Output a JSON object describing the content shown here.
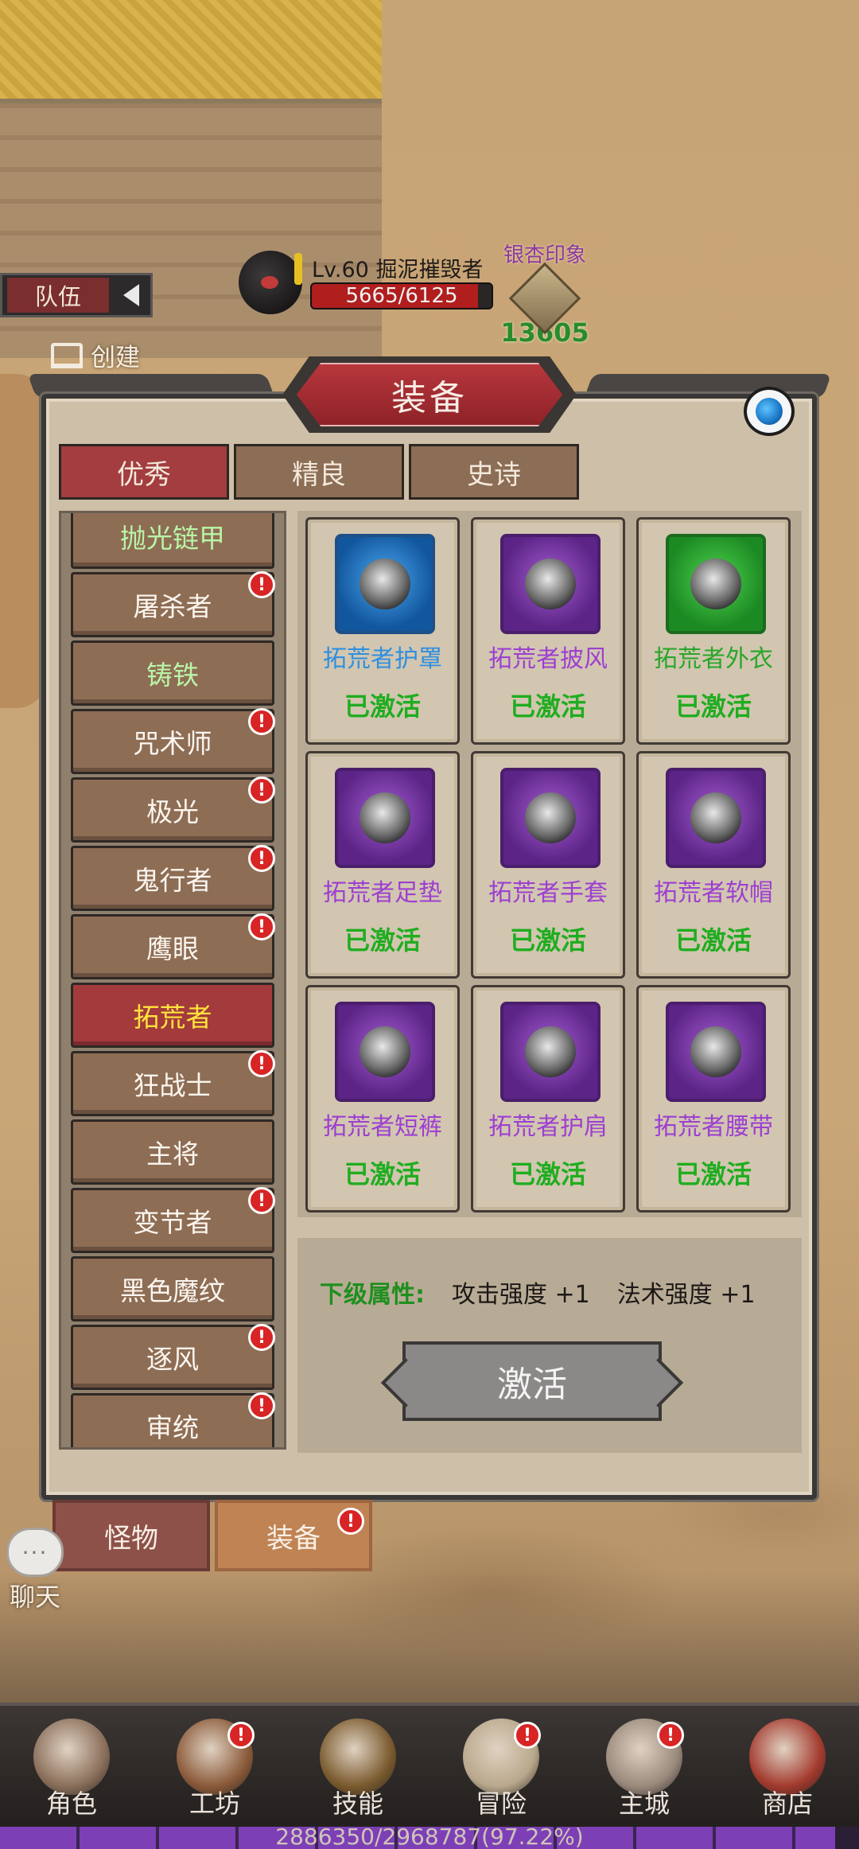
{
  "hud": {
    "team_tab": "队伍",
    "create_label": "创建",
    "boss": {
      "name": "Lv.60 掘泥摧毁者",
      "hp_text": "5665/6125",
      "hp_fraction": 0.925
    },
    "imprint": {
      "title": "银杏印象",
      "value": "13605"
    }
  },
  "panel": {
    "title": "装备",
    "tabs": [
      "优秀",
      "精良",
      "史诗"
    ],
    "list": [
      {
        "label": "抛光链甲",
        "badge": false,
        "style": "green"
      },
      {
        "label": "屠杀者",
        "badge": true
      },
      {
        "label": "铸铁",
        "badge": false,
        "style": "green"
      },
      {
        "label": "咒术师",
        "badge": true
      },
      {
        "label": "极光",
        "badge": true
      },
      {
        "label": "鬼行者",
        "badge": true
      },
      {
        "label": "鹰眼",
        "badge": true
      },
      {
        "label": "拓荒者",
        "badge": false,
        "style": "selected"
      },
      {
        "label": "狂战士",
        "badge": true
      },
      {
        "label": "主将",
        "badge": false
      },
      {
        "label": "变节者",
        "badge": true
      },
      {
        "label": "黑色魔纹",
        "badge": false
      },
      {
        "label": "逐风",
        "badge": true
      },
      {
        "label": "审统",
        "badge": true
      }
    ],
    "items": [
      {
        "name": "拓荒者护罩",
        "rarity": "blue",
        "state": "已激活",
        "icon": "shield-icon"
      },
      {
        "name": "拓荒者披风",
        "rarity": "purple",
        "state": "已激活",
        "icon": "cape-icon"
      },
      {
        "name": "拓荒者外衣",
        "rarity": "green",
        "state": "已激活",
        "icon": "armor-icon"
      },
      {
        "name": "拓荒者足垫",
        "rarity": "purple",
        "state": "已激活",
        "icon": "boots-icon"
      },
      {
        "name": "拓荒者手套",
        "rarity": "purple",
        "state": "已激活",
        "icon": "gloves-icon"
      },
      {
        "name": "拓荒者软帽",
        "rarity": "purple",
        "state": "已激活",
        "icon": "helmet-icon"
      },
      {
        "name": "拓荒者短裤",
        "rarity": "purple",
        "state": "已激活",
        "icon": "pants-icon"
      },
      {
        "name": "拓荒者护肩",
        "rarity": "purple",
        "state": "已激活",
        "icon": "pauldron-icon"
      },
      {
        "name": "拓荒者腰带",
        "rarity": "purple",
        "state": "已激活",
        "icon": "belt-icon"
      }
    ],
    "attributes": {
      "label": "下级属性:",
      "values": [
        "攻击强度 +1",
        "法术强度 +1"
      ]
    },
    "activate_button": "激活"
  },
  "subtabs": [
    {
      "label": "怪物",
      "active": false,
      "badge": false
    },
    {
      "label": "装备",
      "active": true,
      "badge": true
    }
  ],
  "chat": {
    "bubble": "···",
    "label": "聊天"
  },
  "nav": [
    {
      "label": "角色",
      "icon": "character-icon",
      "badge": false
    },
    {
      "label": "工坊",
      "icon": "workshop-icon",
      "badge": true
    },
    {
      "label": "技能",
      "icon": "skills-icon",
      "badge": false
    },
    {
      "label": "冒险",
      "icon": "adventure-icon",
      "badge": true
    },
    {
      "label": "主城",
      "icon": "castle-icon",
      "badge": true
    },
    {
      "label": "商店",
      "icon": "shop-icon",
      "badge": false
    }
  ],
  "xp": {
    "text": "2886350/2968787(97.22%)",
    "fraction": 0.9722
  },
  "badge_mark": "!",
  "colors": {
    "blue": "#2f8fe0",
    "purple": "#9d3fd1",
    "green": "#2aa62a",
    "selected_text": "#ffe43c"
  }
}
